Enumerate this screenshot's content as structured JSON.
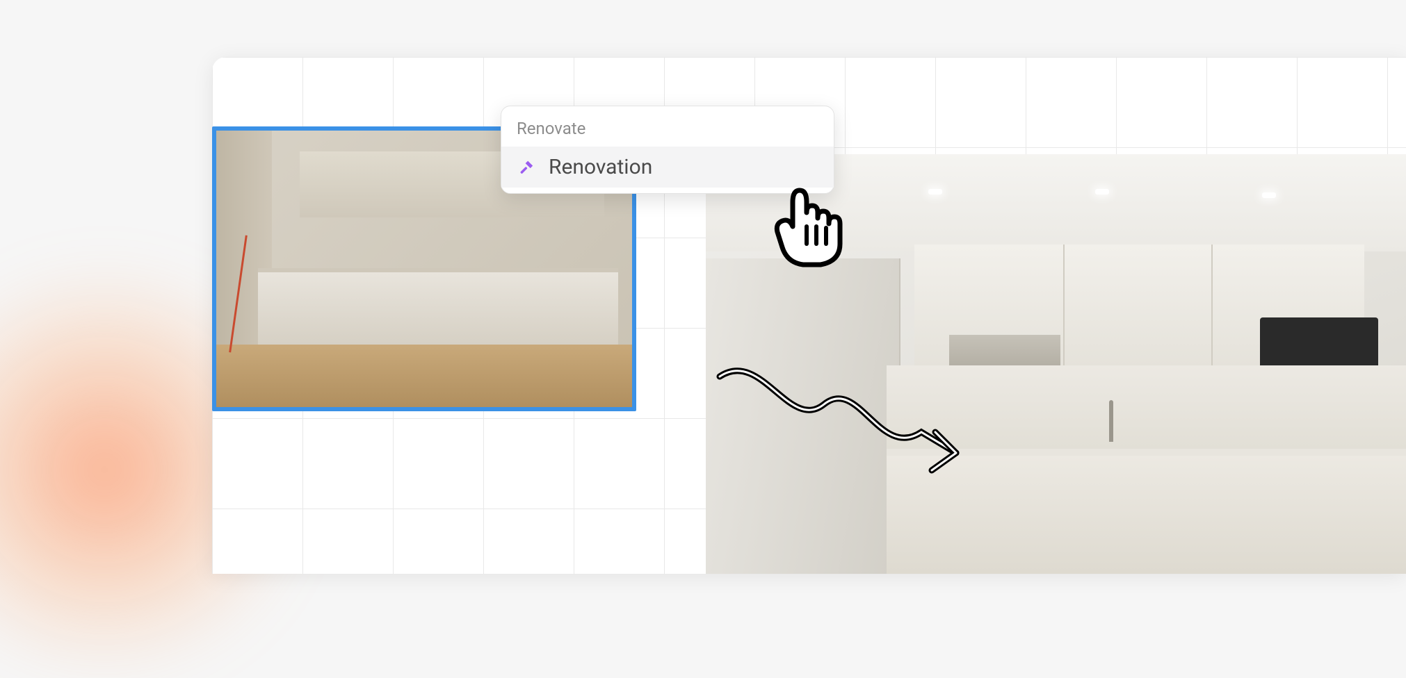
{
  "menu": {
    "search_text": "Renovate",
    "item_label": "Renovation",
    "item_icon_name": "hammer-icon"
  },
  "colors": {
    "selection_border": "#3b91e6",
    "icon_accent": "#9b5cf0",
    "menu_hover": "#f4f4f5"
  }
}
